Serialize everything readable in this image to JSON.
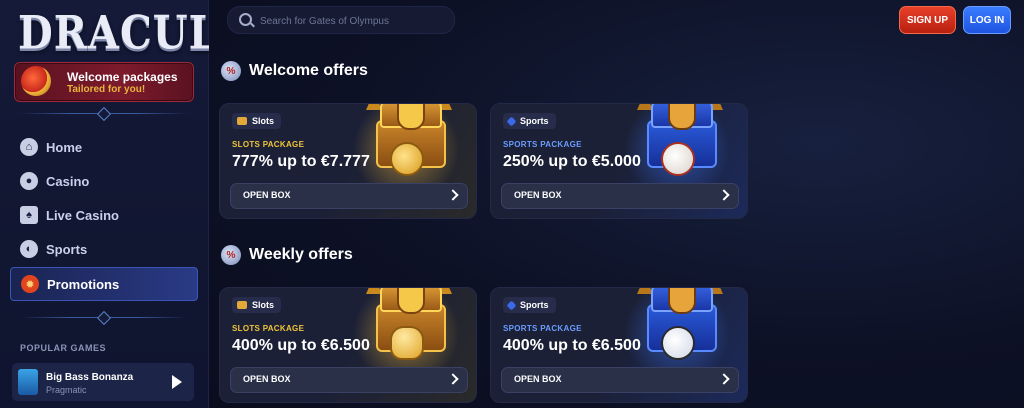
{
  "brand": {
    "logo_text": "DRACULA"
  },
  "sidebar": {
    "welcome_banner": {
      "title": "Welcome packages",
      "subtitle": "Tailored for you!"
    },
    "nav": [
      {
        "label": "Home",
        "icon": "home-icon"
      },
      {
        "label": "Casino",
        "icon": "casino-chip-icon"
      },
      {
        "label": "Live Casino",
        "icon": "cards-icon"
      },
      {
        "label": "Sports",
        "icon": "baseball-icon"
      },
      {
        "label": "Promotions",
        "icon": "promotions-icon",
        "active": true
      }
    ],
    "popular_games_label": "POPULAR GAMES",
    "popular_game": {
      "name": "Big Bass Bonanza",
      "provider": "Pragmatic"
    }
  },
  "header": {
    "search_placeholder": "Search for Gates of Olympus",
    "signup_label": "SIGN UP",
    "login_label": "LOG IN"
  },
  "sections": [
    {
      "title": "Welcome offers",
      "cards": [
        {
          "category": "Slots",
          "package": "SLOTS PACKAGE",
          "amount": "777% up to €7.777",
          "button": "OPEN BOX",
          "kind": "slots",
          "prize": "coin"
        },
        {
          "category": "Sports",
          "package": "SPORTS PACKAGE",
          "amount": "250% up to €5.000",
          "button": "OPEN BOX",
          "kind": "sports",
          "prize": "baseball"
        }
      ]
    },
    {
      "title": "Weekly offers",
      "cards": [
        {
          "category": "Slots",
          "package": "SLOTS PACKAGE",
          "amount": "400% up to €6.500",
          "button": "OPEN BOX",
          "kind": "slots",
          "prize": "bell"
        },
        {
          "category": "Sports",
          "package": "SPORTS PACKAGE",
          "amount": "400% up to €6.500",
          "button": "OPEN BOX",
          "kind": "sports",
          "prize": "soccer"
        }
      ]
    }
  ],
  "colors": {
    "background": "#0b0e1f",
    "sidebar": "#141a38",
    "signup": "#d8321e",
    "login": "#2a66f0",
    "slots_accent": "#f0c43a",
    "sports_accent": "#6a9cff"
  }
}
